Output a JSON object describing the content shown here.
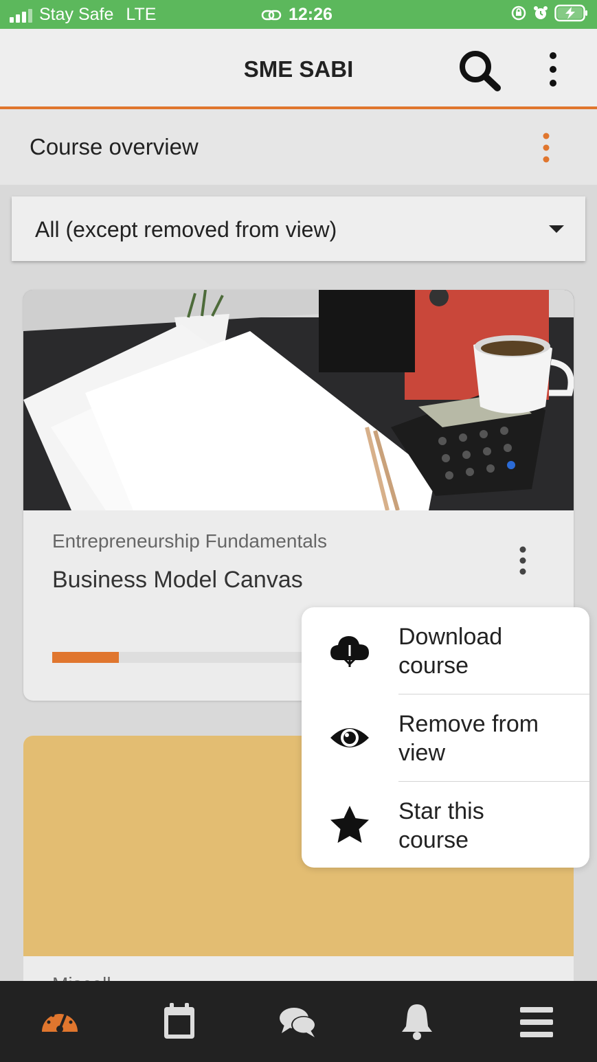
{
  "status_bar": {
    "carrier": "Stay Safe",
    "network": "LTE",
    "time": "12:26"
  },
  "app_bar": {
    "title": "SME SABI",
    "search_icon": "search-icon",
    "more_icon": "more-vertical-icon"
  },
  "page": {
    "title": "Course overview",
    "more_icon": "more-vertical-icon"
  },
  "filter": {
    "selected": "All (except removed from view)"
  },
  "courses": [
    {
      "category": "Entrepreneurship Fundamentals",
      "title": "Business Model Canvas",
      "progress_fraction": 0.135,
      "image": "desk-with-papers-calculator-photo"
    },
    {
      "category": "Miscell...",
      "image_color": "#e3bd72"
    }
  ],
  "context_menu": {
    "items": [
      {
        "label_line1": "Download",
        "label_line2": "course",
        "icon": "cloud-download-icon"
      },
      {
        "label_line1": "Remove from",
        "label_line2": "view",
        "icon": "eye-icon"
      },
      {
        "label_line1": "Star this",
        "label_line2": "course",
        "icon": "star-icon"
      }
    ]
  },
  "bottom_nav": {
    "items": [
      {
        "icon": "dashboard-gauge-icon",
        "active": true
      },
      {
        "icon": "calendar-icon",
        "active": false
      },
      {
        "icon": "messages-icon",
        "active": false
      },
      {
        "icon": "bell-icon",
        "active": false
      },
      {
        "icon": "menu-icon",
        "active": false
      }
    ]
  },
  "colors": {
    "status_bar": "#5cb85c",
    "accent": "#e0762e",
    "nav_bg": "#222222",
    "card2_image": "#e3bd72"
  }
}
